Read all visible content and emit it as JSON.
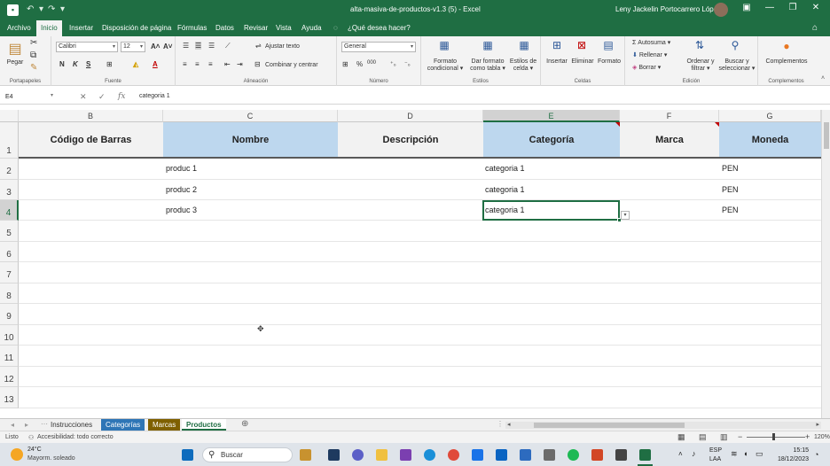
{
  "window": {
    "title": "alta-masiva-de-productos-v1.3 (5)  -  Excel",
    "user": "Leny Jackelin Portocarrero López"
  },
  "menu_tabs": [
    "Archivo",
    "Inicio",
    "Insertar",
    "Disposición de página",
    "Fórmulas",
    "Datos",
    "Revisar",
    "Vista",
    "Ayuda"
  ],
  "tell_me": "¿Qué desea hacer?",
  "ribbon": {
    "paste_label": "Pegar",
    "font_name": "Calibri",
    "font_size": "12",
    "wrap_text": "Ajustar texto",
    "merge_center": "Combinar y centrar",
    "number_format": "General",
    "cond_format": [
      "Formato",
      "condicional"
    ],
    "format_table": [
      "Dar formato",
      "como tabla"
    ],
    "cell_styles": [
      "Estilos de",
      "celda"
    ],
    "insert": "Insertar",
    "delete": "Eliminar",
    "format": "Formato",
    "autosum": "Autosuma",
    "fill": "Rellenar",
    "clear": "Borrar",
    "sort_filter": [
      "Ordenar y",
      "filtrar"
    ],
    "find_select": [
      "Buscar y",
      "seleccionar"
    ],
    "addins": "Complementos",
    "groups": [
      "Portapapeles",
      "Fuente",
      "Alineación",
      "Número",
      "Estilos",
      "Celdas",
      "Edición",
      "Complementos"
    ]
  },
  "formula_bar": {
    "name_box": "E4",
    "content": "categoria 1"
  },
  "grid": {
    "columns": [
      "B",
      "C",
      "D",
      "E",
      "F",
      "G"
    ],
    "rows": [
      "1",
      "2",
      "3",
      "4",
      "5",
      "6",
      "7",
      "8",
      "9",
      "10",
      "11",
      "12",
      "13"
    ],
    "headers": [
      "Código de Barras",
      "Nombre",
      "Descripción",
      "Categoría",
      "Marca",
      "Moneda"
    ],
    "data": [
      {
        "nombre": "produc 1",
        "categoria": "categoria 1",
        "moneda": "PEN"
      },
      {
        "nombre": "produc 2",
        "categoria": "categoria 1",
        "moneda": "PEN"
      },
      {
        "nombre": "produc 3",
        "categoria": "categoria 1",
        "moneda": "PEN"
      }
    ]
  },
  "sheets": [
    "Instrucciones",
    "Categorías",
    "Marcas",
    "Productos"
  ],
  "sheet_colors": {
    "Categorías": "#2e75b6",
    "Marcas": "#7f6000"
  },
  "status": {
    "ready": "Listo",
    "accessibility": "Accesibilidad: todo correcto",
    "zoom": "120%"
  },
  "taskbar": {
    "weather_temp": "24°C",
    "weather_desc": "Mayorm. soleado",
    "search": "Buscar",
    "lang1": "ESP",
    "lang2": "LAA",
    "time": "15:15",
    "date": "18/12/2023"
  }
}
